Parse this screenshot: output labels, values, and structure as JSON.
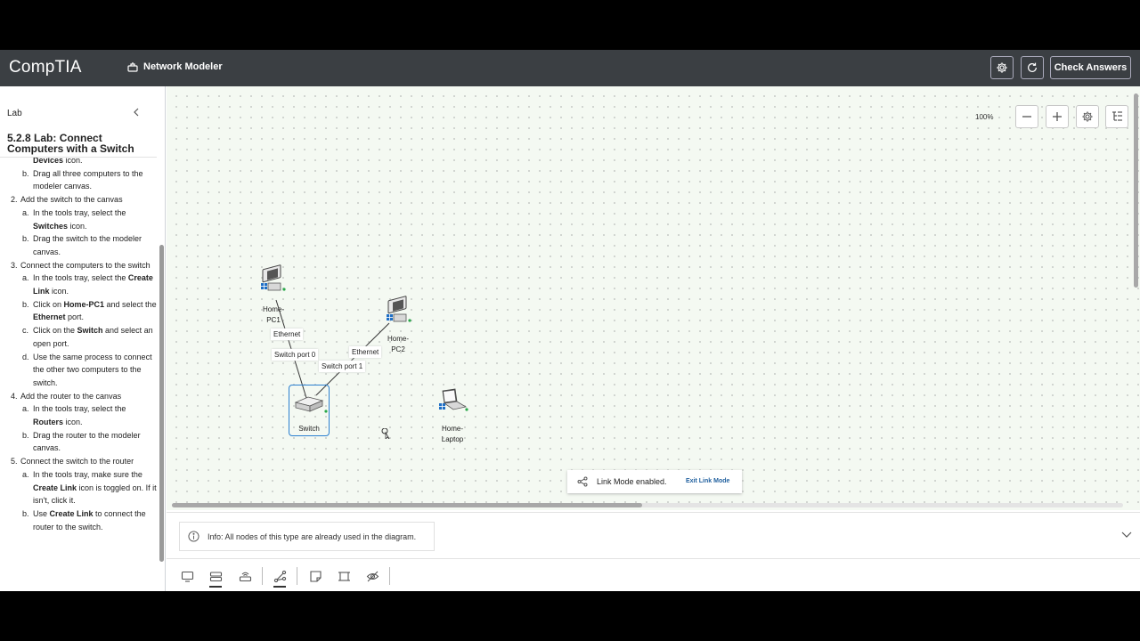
{
  "header": {
    "logo": "CompTIA",
    "app_title": "Network Modeler",
    "settings_icon": "gear-icon",
    "reset_icon": "refresh-icon",
    "check_answers": "Check Answers"
  },
  "sidebar": {
    "section_label": "Lab",
    "title": "5.2.8 Lab: Connect Computers with a Switch",
    "steps": [
      {
        "num": "",
        "text": "",
        "subs": [
          {
            "letter": "",
            "html": "<b>Devices</b> icon."
          },
          {
            "letter": "b.",
            "html": "Drag all three computers to the modeler canvas."
          }
        ]
      },
      {
        "num": "2.",
        "text": "Add the switch to the canvas",
        "subs": [
          {
            "letter": "a.",
            "html": "In the tools tray, select the <b>Switches</b> icon."
          },
          {
            "letter": "b.",
            "html": "Drag the switch to the modeler canvas."
          }
        ]
      },
      {
        "num": "3.",
        "text": "Connect the computers to the switch",
        "subs": [
          {
            "letter": "a.",
            "html": "In the tools tray, select the <b>Create Link</b> icon."
          },
          {
            "letter": "b.",
            "html": "Click on <b>Home-PC1</b> and select the <b>Ethernet</b> port."
          },
          {
            "letter": "c.",
            "html": "Click on the <b>Switch</b> and select an open port."
          },
          {
            "letter": "d.",
            "html": "Use the same process to connect the other two computers to the switch."
          }
        ]
      },
      {
        "num": "4.",
        "text": "Add the router to the canvas",
        "subs": [
          {
            "letter": "a.",
            "html": "In the tools tray, select the <b>Routers</b> icon."
          },
          {
            "letter": "b.",
            "html": "Drag the router to the modeler canvas."
          }
        ]
      },
      {
        "num": "5.",
        "text": "Connect the switch to the router",
        "subs": [
          {
            "letter": "a.",
            "html": "In the tools tray, make sure the <b>Create Link</b> icon is toggled on. If it isn't, click it."
          },
          {
            "letter": "b.",
            "html": "Use <b>Create Link</b> to connect the router to the switch."
          }
        ]
      }
    ]
  },
  "canvas": {
    "zoom": "100%",
    "nodes": {
      "pc1": [
        "Home-",
        "PC1"
      ],
      "pc2": [
        "Home-",
        "PC2"
      ],
      "switch": "Switch",
      "laptop": [
        "Home-",
        "Laptop"
      ]
    },
    "ports": {
      "pc1_ethernet": "Ethernet",
      "pc2_ethernet": "Ethernet",
      "switch_port0": "Switch port 0",
      "switch_port1": "Switch port 1"
    },
    "toast": {
      "message": "Link Mode enabled.",
      "exit": "Exit Link Mode"
    }
  },
  "info": {
    "message": "Info: All nodes of this type are already used in the diagram."
  },
  "tray": {
    "tools": [
      "devices-icon",
      "switches-icon",
      "routers-icon",
      "create-link-icon",
      "note-icon",
      "frame-icon",
      "hide-icon"
    ]
  },
  "colors": {
    "header_bg": "#3b3f43",
    "canvas_bg": "#f4f9f2",
    "selection": "#2a7fd0",
    "link_accent": "#1f5f9e"
  }
}
